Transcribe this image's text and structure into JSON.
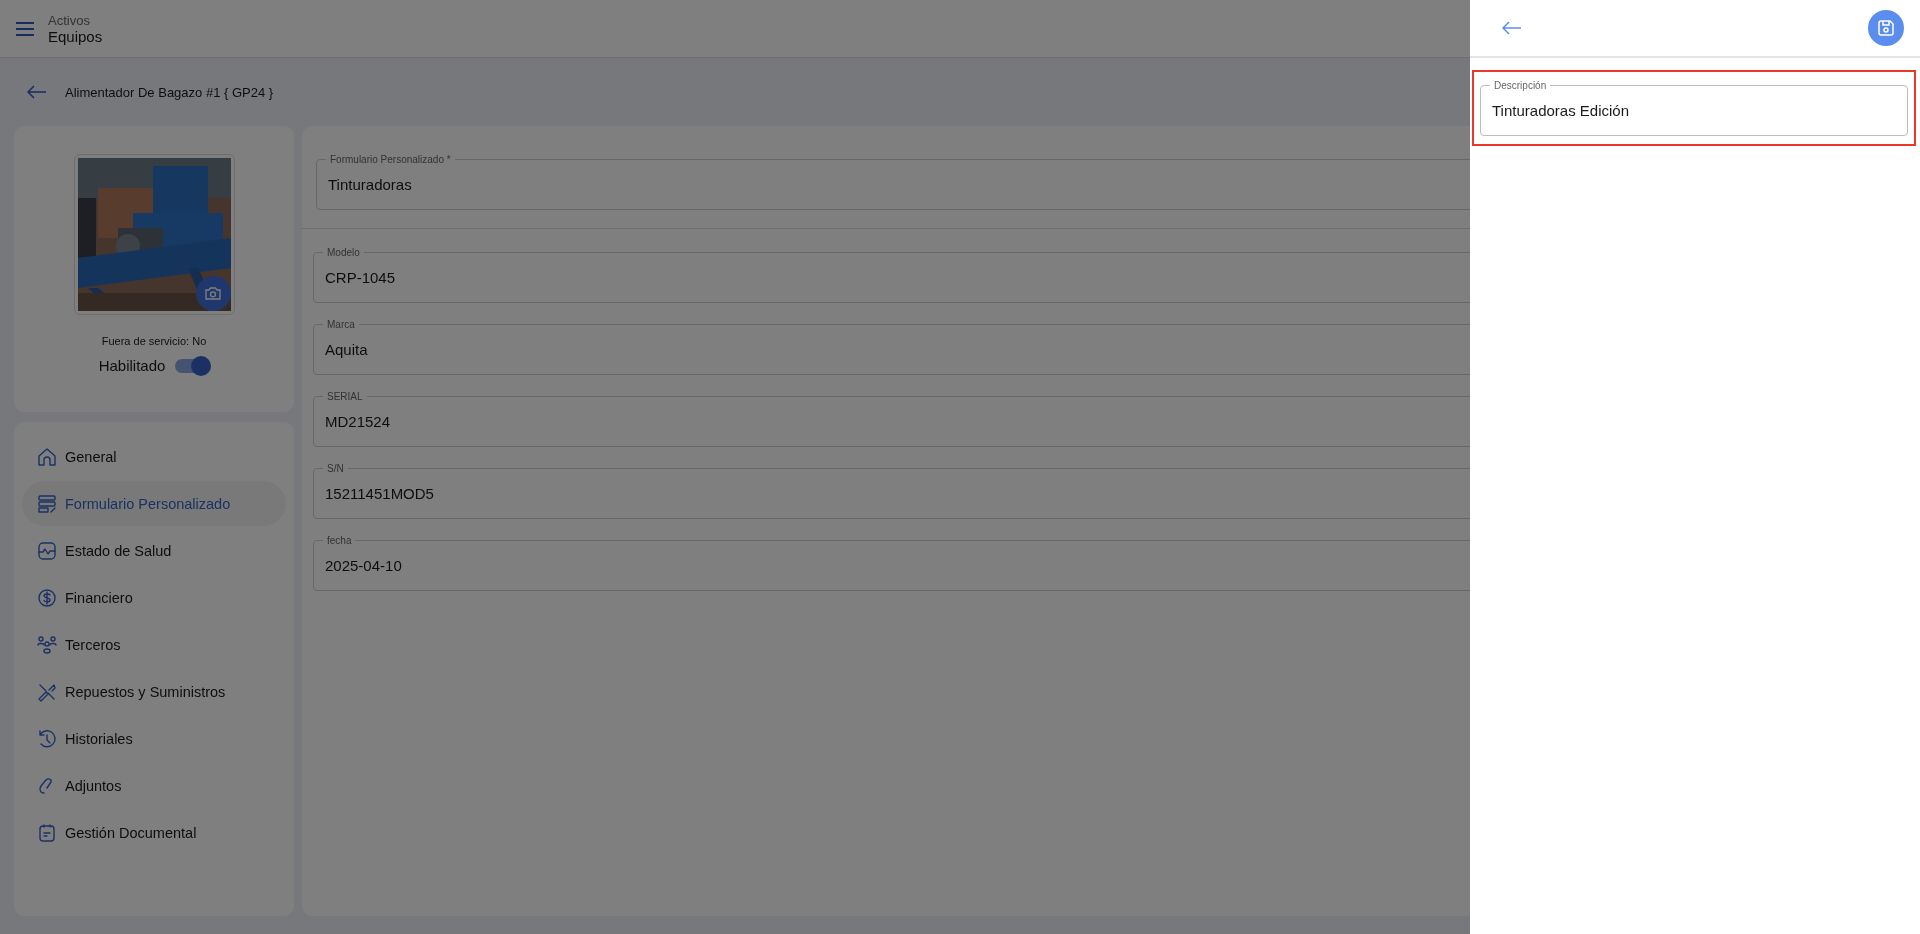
{
  "header": {
    "section": "Activos",
    "title": "Equipos"
  },
  "page": {
    "title": "Alimentador De Bagazo #1 { GP24 }"
  },
  "asset_card": {
    "out_of_service": "Fuera de servicio: No",
    "enabled_label": "Habilitado",
    "enabled": {
      "on": true
    }
  },
  "nav": [
    {
      "label": "General",
      "selected": false
    },
    {
      "label": "Formulario Personalizado",
      "selected": true
    },
    {
      "label": "Estado de Salud",
      "selected": false
    },
    {
      "label": "Financiero",
      "selected": false
    },
    {
      "label": "Terceros",
      "selected": false
    },
    {
      "label": "Repuestos y Suministros",
      "selected": false
    },
    {
      "label": "Historiales",
      "selected": false
    },
    {
      "label": "Adjuntos",
      "selected": false
    },
    {
      "label": "Gestión Documental",
      "selected": false
    }
  ],
  "form": {
    "template": {
      "label": "Formulario Personalizado *",
      "value": "Tinturadoras"
    },
    "fields": [
      {
        "label": "Modelo",
        "value": "CRP-1045"
      },
      {
        "label": "Marca",
        "value": "Aquita"
      },
      {
        "label": "SERIAL",
        "value": "MD21524"
      },
      {
        "label": "S/N",
        "value": "15211451MOD5"
      },
      {
        "label": "fecha",
        "value": "2025-04-10"
      }
    ]
  },
  "drawer": {
    "field": {
      "label": "Descripción",
      "value": "Tinturadoras Edición",
      "highlighted": true
    }
  }
}
